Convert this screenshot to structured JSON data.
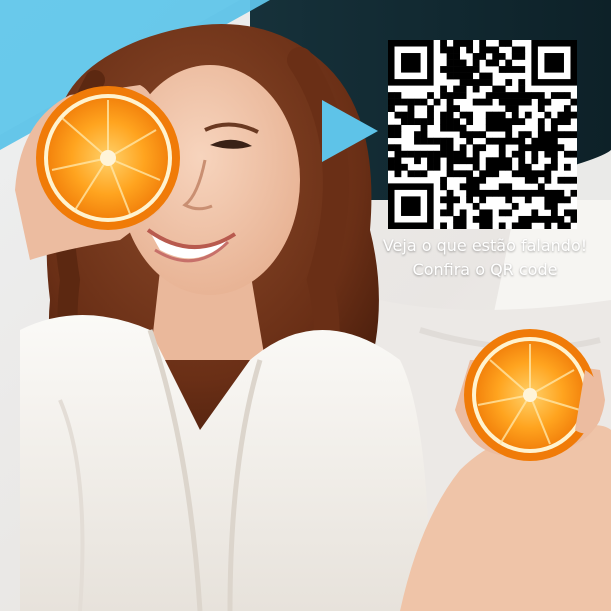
{
  "promo": {
    "line1": "Veja o que estão falando!",
    "line2": "Confira o QR code"
  },
  "colors": {
    "accent_blue": "#5ec3e8",
    "orange": "#f28c12",
    "orange_light": "#ffb13b",
    "robe": "#f2efea",
    "hair": "#7a3a1d",
    "skin": "#f2c6aa"
  },
  "icons": [
    "play-arrow-icon",
    "qr-code"
  ]
}
